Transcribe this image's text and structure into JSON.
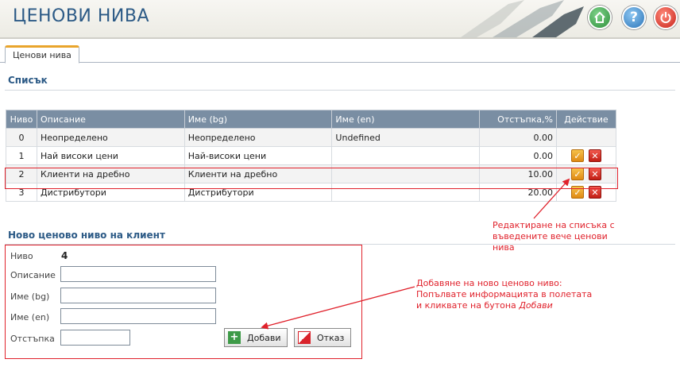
{
  "header": {
    "title": "ЦЕНОВИ НИВА"
  },
  "tabs": [
    {
      "label": "Ценови нива"
    }
  ],
  "list": {
    "title": "Списък",
    "columns": [
      "Ниво",
      "Описание",
      "Име (bg)",
      "Име (en)",
      "Отстъпка,%",
      "Действие"
    ],
    "rows": [
      {
        "level": "0",
        "description": "Неопределено",
        "name_bg": "Неопределено",
        "name_en": "Undefined",
        "discount": "0.00",
        "actions": false
      },
      {
        "level": "1",
        "description": "Най високи цени",
        "name_bg": "Най-високи цени",
        "name_en": "",
        "discount": "0.00",
        "actions": true
      },
      {
        "level": "2",
        "description": "Клиенти на дребно",
        "name_bg": "Клиенти на дребно",
        "name_en": "",
        "discount": "10.00",
        "actions": true
      },
      {
        "level": "3",
        "description": "Дистрибутори",
        "name_bg": "Дистрибутори",
        "name_en": "",
        "discount": "20.00",
        "actions": true
      }
    ]
  },
  "form": {
    "title": "Ново ценово ниво на клиент",
    "level_label": "Ниво",
    "level_value": "4",
    "description_label": "Описание",
    "description_value": "",
    "name_bg_label": "Име (bg)",
    "name_bg_value": "",
    "name_en_label": "Име (en)",
    "name_en_value": "",
    "discount_label": "Отстъпка",
    "discount_value": "",
    "add_label": "Добави",
    "cancel_label": "Отказ"
  },
  "annotations": {
    "edit_note": [
      "Редактиране на списъка с",
      "въведените вече ценови",
      "нива"
    ],
    "add_note_line1": "Добавяне на ново ценово ниво:",
    "add_note_line2": "Попълвате информацията в полетата",
    "add_note_line3_prefix": "и кликвате на бутона ",
    "add_note_line3_em": "Добави"
  },
  "colors": {
    "accent": "#2c5a86",
    "table_header": "#7a8ea3",
    "annotation": "#e0212b",
    "tab_top": "#e9a52c"
  },
  "icons": {
    "home": "home-icon",
    "help": "help-icon",
    "power": "power-icon",
    "edit": "edit-icon",
    "delete": "delete-icon",
    "add": "plus-icon",
    "cancel": "cancel-icon"
  }
}
